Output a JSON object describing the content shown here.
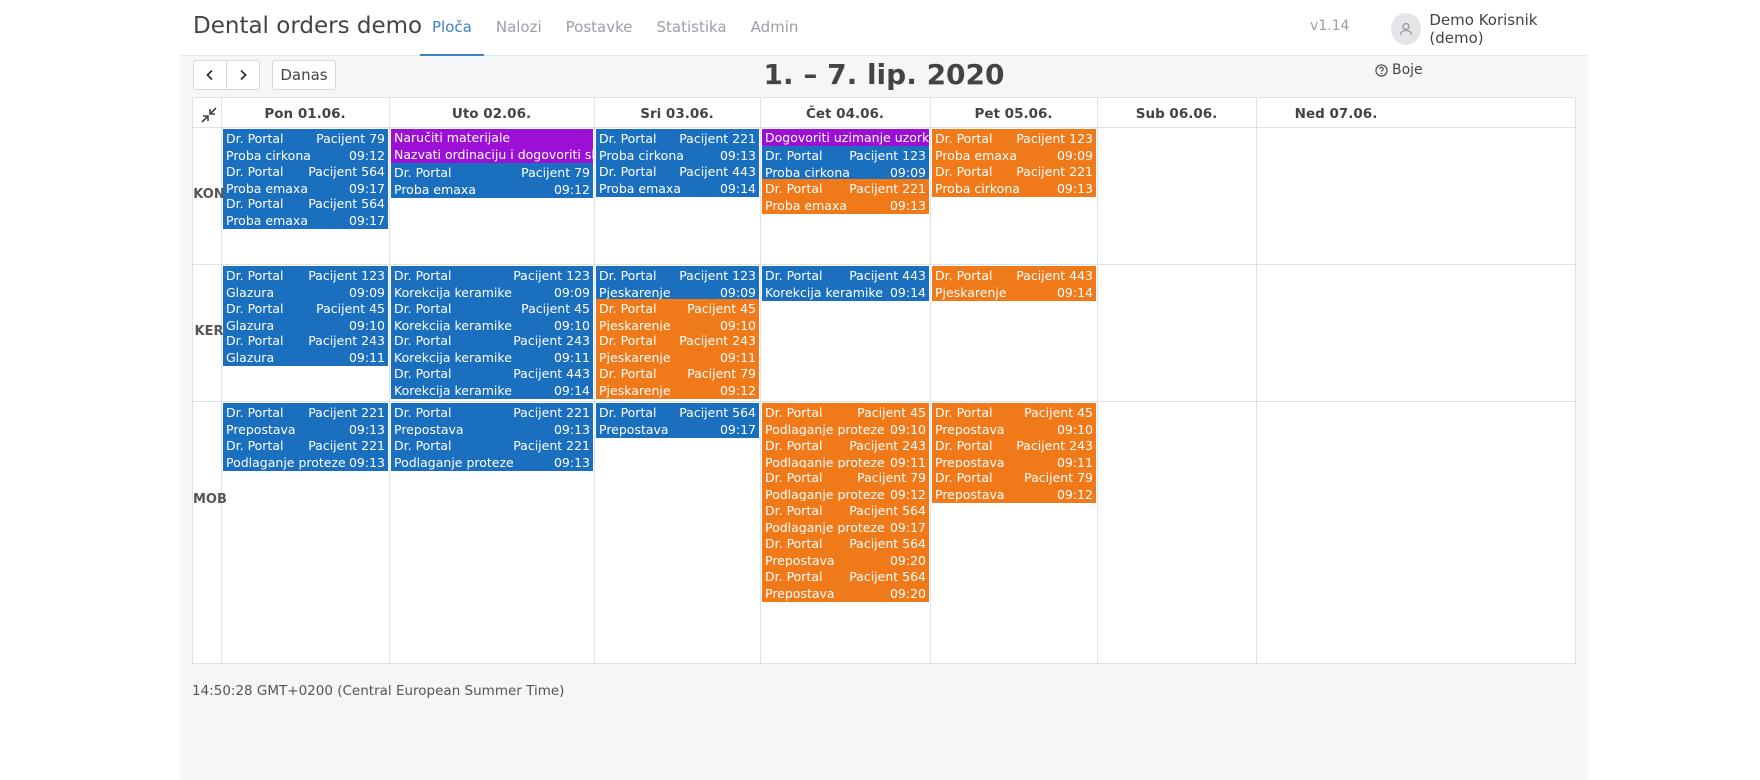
{
  "app": {
    "title": "Dental orders demo",
    "version": "v1.14"
  },
  "nav": [
    {
      "label": "Ploča",
      "active": true
    },
    {
      "label": "Nalozi",
      "active": false
    },
    {
      "label": "Postavke",
      "active": false
    },
    {
      "label": "Statistika",
      "active": false
    },
    {
      "label": "Admin",
      "active": false
    }
  ],
  "user": {
    "name": "Demo Korisnik (demo)",
    "icon": "user-icon"
  },
  "toolbar": {
    "today_label": "Danas",
    "week_title": "1. – 7. lip. 2020",
    "colors_label": "Boje",
    "prev_icon": "chevron-left-icon",
    "next_icon": "chevron-right-icon",
    "help_icon": "question-circle-icon"
  },
  "colors": {
    "blue": "#1a6fbf",
    "orange": "#f07a1a",
    "purple": "#9c10d6",
    "accent": "#3b82c8"
  },
  "days": [
    "Pon 01.06.",
    "Uto 02.06.",
    "Sri 03.06.",
    "Čet 04.06.",
    "Pet 05.06.",
    "Sub 06.06.",
    "Ned 07.06."
  ],
  "rows": [
    {
      "label": "KON",
      "cells": [
        {
          "tasks": [],
          "events": [
            {
              "doctor": "Dr. Portal",
              "patient": "Pacijent 79",
              "work": "Proba cirkona",
              "time": "09:12",
              "color": "blue"
            },
            {
              "doctor": "Dr. Portal",
              "patient": "Pacijent 564",
              "work": "Proba emaxa",
              "time": "09:17",
              "color": "blue"
            },
            {
              "doctor": "Dr. Portal",
              "patient": "Pacijent 564",
              "work": "Proba emaxa",
              "time": "09:17",
              "color": "blue"
            }
          ]
        },
        {
          "tasks": [
            "Naručiti materijale",
            "Nazvati ordinaciju i dogovoriti slikanje"
          ],
          "events": [
            {
              "doctor": "Dr. Portal",
              "patient": "Pacijent 79",
              "work": "Proba emaxa",
              "time": "09:12",
              "color": "blue"
            }
          ]
        },
        {
          "tasks": [],
          "events": [
            {
              "doctor": "Dr. Portal",
              "patient": "Pacijent 221",
              "work": "Proba cirkona",
              "time": "09:13",
              "color": "blue"
            },
            {
              "doctor": "Dr. Portal",
              "patient": "Pacijent 443",
              "work": "Proba emaxa",
              "time": "09:14",
              "color": "blue"
            }
          ]
        },
        {
          "tasks": [
            "Dogovoriti uzimanje uzorka"
          ],
          "events": [
            {
              "doctor": "Dr. Portal",
              "patient": "Pacijent 123",
              "work": "Proba cirkona",
              "time": "09:09",
              "color": "blue"
            },
            {
              "doctor": "Dr. Portal",
              "patient": "Pacijent 221",
              "work": "Proba emaxa",
              "time": "09:13",
              "color": "orange"
            }
          ]
        },
        {
          "tasks": [],
          "events": [
            {
              "doctor": "Dr. Portal",
              "patient": "Pacijent 123",
              "work": "Proba emaxa",
              "time": "09:09",
              "color": "orange"
            },
            {
              "doctor": "Dr. Portal",
              "patient": "Pacijent 221",
              "work": "Proba cirkona",
              "time": "09:13",
              "color": "orange"
            }
          ]
        },
        {
          "tasks": [],
          "events": []
        },
        {
          "tasks": [],
          "events": []
        }
      ]
    },
    {
      "label": "KER",
      "cells": [
        {
          "tasks": [],
          "events": [
            {
              "doctor": "Dr. Portal",
              "patient": "Pacijent 123",
              "work": "Glazura",
              "time": "09:09",
              "color": "blue"
            },
            {
              "doctor": "Dr. Portal",
              "patient": "Pacijent 45",
              "work": "Glazura",
              "time": "09:10",
              "color": "blue"
            },
            {
              "doctor": "Dr. Portal",
              "patient": "Pacijent 243",
              "work": "Glazura",
              "time": "09:11",
              "color": "blue"
            }
          ]
        },
        {
          "tasks": [],
          "events": [
            {
              "doctor": "Dr. Portal",
              "patient": "Pacijent 123",
              "work": "Korekcija keramike",
              "time": "09:09",
              "color": "blue"
            },
            {
              "doctor": "Dr. Portal",
              "patient": "Pacijent 45",
              "work": "Korekcija keramike",
              "time": "09:10",
              "color": "blue"
            },
            {
              "doctor": "Dr. Portal",
              "patient": "Pacijent 243",
              "work": "Korekcija keramike",
              "time": "09:11",
              "color": "blue"
            },
            {
              "doctor": "Dr. Portal",
              "patient": "Pacijent 443",
              "work": "Korekcija keramike",
              "time": "09:14",
              "color": "blue"
            }
          ]
        },
        {
          "tasks": [],
          "events": [
            {
              "doctor": "Dr. Portal",
              "patient": "Pacijent 123",
              "work": "Pjeskarenje",
              "time": "09:09",
              "color": "blue"
            },
            {
              "doctor": "Dr. Portal",
              "patient": "Pacijent 45",
              "work": "Pjeskarenje",
              "time": "09:10",
              "color": "orange"
            },
            {
              "doctor": "Dr. Portal",
              "patient": "Pacijent 243",
              "work": "Pjeskarenje",
              "time": "09:11",
              "color": "orange"
            },
            {
              "doctor": "Dr. Portal",
              "patient": "Pacijent 79",
              "work": "Pjeskarenje",
              "time": "09:12",
              "color": "orange"
            }
          ]
        },
        {
          "tasks": [],
          "events": [
            {
              "doctor": "Dr. Portal",
              "patient": "Pacijent 443",
              "work": "Korekcija keramike",
              "time": "09:14",
              "color": "blue"
            }
          ]
        },
        {
          "tasks": [],
          "events": [
            {
              "doctor": "Dr. Portal",
              "patient": "Pacijent 443",
              "work": "Pjeskarenje",
              "time": "09:14",
              "color": "orange"
            }
          ]
        },
        {
          "tasks": [],
          "events": []
        },
        {
          "tasks": [],
          "events": []
        }
      ]
    },
    {
      "label": "MOB",
      "cells": [
        {
          "tasks": [],
          "events": [
            {
              "doctor": "Dr. Portal",
              "patient": "Pacijent 221",
              "work": "Prepostava",
              "time": "09:13",
              "color": "blue"
            },
            {
              "doctor": "Dr. Portal",
              "patient": "Pacijent 221",
              "work": "Podlaganje proteze",
              "time": "09:13",
              "color": "blue"
            }
          ]
        },
        {
          "tasks": [],
          "events": [
            {
              "doctor": "Dr. Portal",
              "patient": "Pacijent 221",
              "work": "Prepostava",
              "time": "09:13",
              "color": "blue"
            },
            {
              "doctor": "Dr. Portal",
              "patient": "Pacijent 221",
              "work": "Podlaganje proteze",
              "time": "09:13",
              "color": "blue"
            }
          ]
        },
        {
          "tasks": [],
          "events": [
            {
              "doctor": "Dr. Portal",
              "patient": "Pacijent 564",
              "work": "Prepostava",
              "time": "09:17",
              "color": "blue"
            }
          ]
        },
        {
          "tasks": [],
          "events": [
            {
              "doctor": "Dr. Portal",
              "patient": "Pacijent 45",
              "work": "Podlaganje proteze",
              "time": "09:10",
              "color": "orange"
            },
            {
              "doctor": "Dr. Portal",
              "patient": "Pacijent 243",
              "work": "Podlaganje proteze",
              "time": "09:11",
              "color": "orange"
            },
            {
              "doctor": "Dr. Portal",
              "patient": "Pacijent 79",
              "work": "Podlaganje proteze",
              "time": "09:12",
              "color": "orange"
            },
            {
              "doctor": "Dr. Portal",
              "patient": "Pacijent 564",
              "work": "Podlaganje proteze",
              "time": "09:17",
              "color": "orange"
            },
            {
              "doctor": "Dr. Portal",
              "patient": "Pacijent 564",
              "work": "Prepostava",
              "time": "09:20",
              "color": "orange"
            },
            {
              "doctor": "Dr. Portal",
              "patient": "Pacijent 564",
              "work": "Prepostava",
              "time": "09:20",
              "color": "orange"
            }
          ]
        },
        {
          "tasks": [],
          "events": [
            {
              "doctor": "Dr. Portal",
              "patient": "Pacijent 45",
              "work": "Prepostava",
              "time": "09:10",
              "color": "orange"
            },
            {
              "doctor": "Dr. Portal",
              "patient": "Pacijent 243",
              "work": "Prepostava",
              "time": "09:11",
              "color": "orange"
            },
            {
              "doctor": "Dr. Portal",
              "patient": "Pacijent 79",
              "work": "Prepostava",
              "time": "09:12",
              "color": "orange"
            }
          ]
        },
        {
          "tasks": [],
          "events": []
        },
        {
          "tasks": [],
          "events": []
        }
      ]
    }
  ],
  "footer": {
    "time": "14:50:28 GMT+0200 (Central European Summer Time)"
  }
}
